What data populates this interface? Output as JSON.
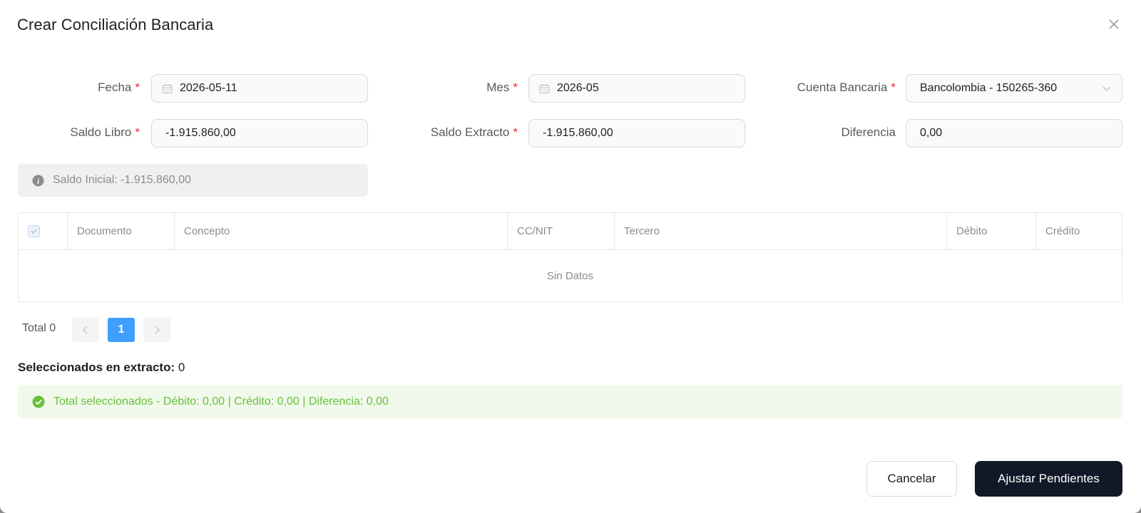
{
  "dialog": {
    "title": "Crear Conciliación Bancaria"
  },
  "form": {
    "fecha": {
      "label": "Fecha",
      "value": "2026-05-11"
    },
    "mes": {
      "label": "Mes",
      "value": "2026-05"
    },
    "cuenta": {
      "label": "Cuenta Bancaria",
      "value": "Bancolombia - 150265-360"
    },
    "saldo_libro": {
      "label": "Saldo Libro",
      "value": "-1.915.860,00"
    },
    "saldo_extracto": {
      "label": "Saldo Extracto",
      "value": "-1.915.860,00"
    },
    "diferencia": {
      "label": "Diferencia",
      "value": "0,00"
    },
    "required_mark": "*"
  },
  "info": {
    "text": "Saldo Inicial: -1.915.860,00",
    "icon": "info-icon"
  },
  "table": {
    "columns": [
      "Documento",
      "Concepto",
      "CC/NIT",
      "Tercero",
      "Débito",
      "Crédito"
    ],
    "empty_text": "Sin Datos"
  },
  "pagination": {
    "total_label": "Total 0",
    "current_page": "1"
  },
  "selection": {
    "label": "Seleccionados en extracto:",
    "count": "0"
  },
  "summary": {
    "text": "Total seleccionados - Débito: 0,00 | Crédito: 0,00 | Diferencia: 0,00",
    "icon": "check-circle-icon"
  },
  "actions": {
    "cancel": "Cancelar",
    "primary": "Ajustar Pendientes"
  },
  "colors": {
    "primary_button": "#111827",
    "page_active": "#409eff",
    "success": "#67c23a",
    "required": "#f5222d"
  }
}
